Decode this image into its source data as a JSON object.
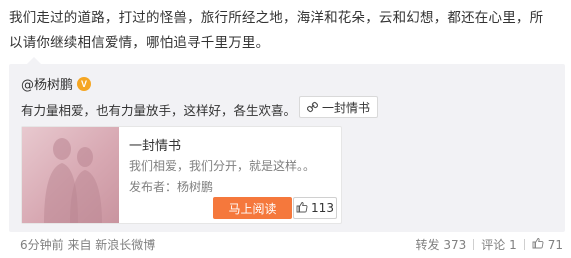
{
  "post": {
    "text_line1": "我们走过的道路，打过的怪兽，旅行所经之地，海洋和花朵，云和幻想，都还在心里，所",
    "text_line2": "以请你继续相信爱情，哪怕追寻千里万里。"
  },
  "repost": {
    "author": "@杨树鹏",
    "verified_badge": "V",
    "text": "有力量相爱，也有力量放手，这样好，各生欢喜。",
    "link_chip_label": "一封情书",
    "card": {
      "title": "一封情书",
      "description": "我们相爱，我们分开，就是这样。。",
      "publisher": "发布者：杨树鹏",
      "read_button": "马上阅读",
      "likes": "113"
    },
    "footer": {
      "time_source": "6分钟前 来自 新浪长微博",
      "repost": "转发 373",
      "comment": "评论 1",
      "likes": "71"
    }
  },
  "colors": {
    "accent_orange": "#f5783c",
    "badge": "#f5a623",
    "panel_bg": "#f2f2f5",
    "muted_text": "#808080"
  },
  "icons": [
    "link-icon",
    "thumbs-up-icon",
    "verified-badge-icon"
  ]
}
